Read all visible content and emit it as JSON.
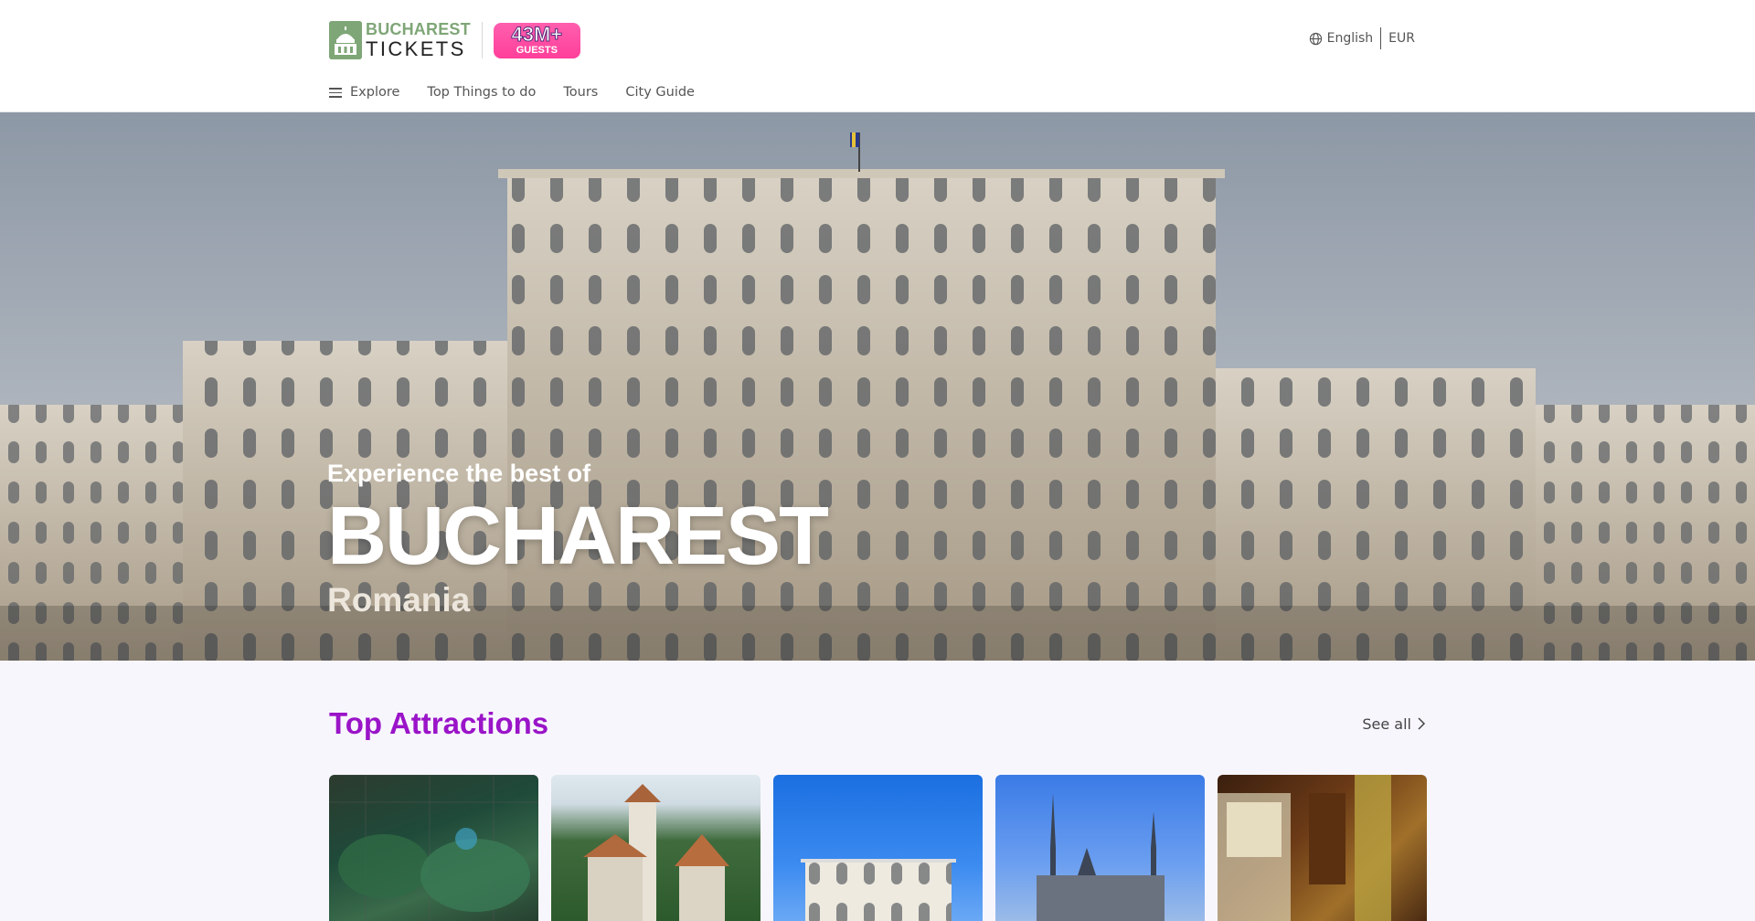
{
  "header": {
    "logo_line1": "BUCHAREST",
    "logo_line2": "TICKETS",
    "guests_count": "43M+",
    "guests_label": "GUESTS",
    "language": "English",
    "currency": "EUR"
  },
  "nav": {
    "items": [
      {
        "label": "Explore"
      },
      {
        "label": "Top Things to do"
      },
      {
        "label": "Tours"
      },
      {
        "label": "City Guide"
      }
    ]
  },
  "hero": {
    "subtitle": "Experience the best of",
    "title": "BUCHAREST",
    "country": "Romania"
  },
  "attractions": {
    "title": "Top Attractions",
    "see_all": "See all"
  },
  "colors": {
    "brand_green": "#7fa677",
    "accent_pink": "#ff4fa3",
    "section_purple": "#9a14c8"
  }
}
